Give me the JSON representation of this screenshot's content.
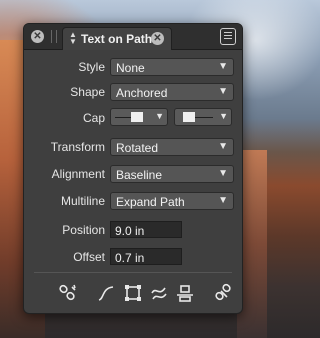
{
  "panel": {
    "title": "Text on Path",
    "close_glyph": "✕",
    "updown_glyph": "⬍",
    "chevron": "⌄"
  },
  "fields": {
    "style": {
      "label": "Style",
      "value": "None"
    },
    "shape": {
      "label": "Shape",
      "value": "Anchored"
    },
    "cap": {
      "label": "Cap"
    },
    "transform": {
      "label": "Transform",
      "value": "Rotated"
    },
    "alignment": {
      "label": "Alignment",
      "value": "Baseline"
    },
    "multiline": {
      "label": "Multiline",
      "value": "Expand Path"
    },
    "position": {
      "label": "Position",
      "value": "9.0 in"
    },
    "offset": {
      "label": "Offset",
      "value": "0.7 in"
    }
  },
  "toolbar": {
    "icons": [
      "unlink-text-icon",
      "curve-path-icon",
      "bounding-box-icon",
      "wave-path-icon",
      "align-baseline-icon",
      "detach-icon"
    ]
  }
}
